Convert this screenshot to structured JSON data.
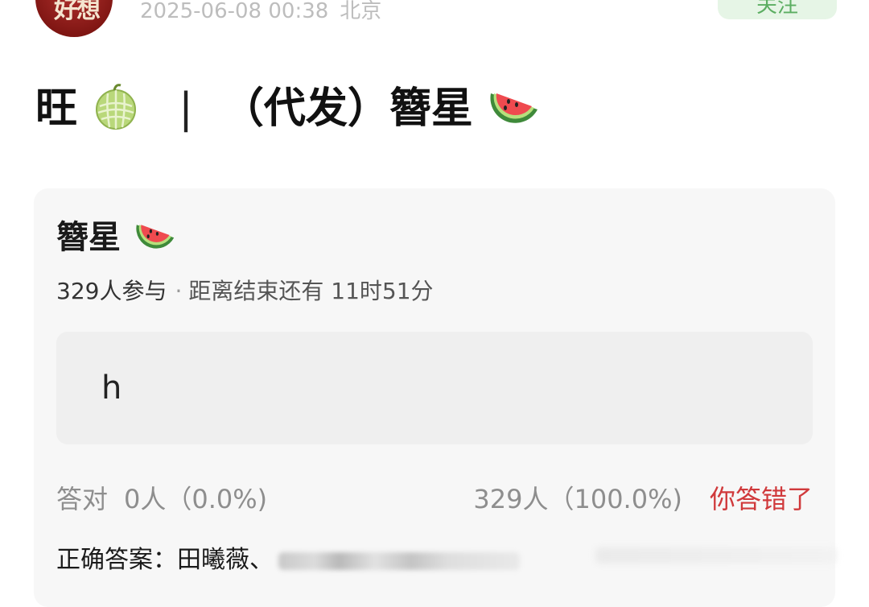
{
  "header": {
    "avatar_text": "好想",
    "timestamp": "2025-06-08 00:38",
    "location": "北京",
    "follow_label": "关注"
  },
  "post": {
    "title_prefix": "旺",
    "separator": "|",
    "title_main": "（代发）簪星",
    "title_icon_1": "melon-emoji-icon",
    "title_icon_2": "watermelon-emoji-icon"
  },
  "quiz": {
    "title": "簪星",
    "participants": "329人参与",
    "dot": "·",
    "countdown": "距离结束还有 11时51分",
    "answer": "h",
    "correct_label": "答对",
    "correct_stat": "0人（0.0%)",
    "answer_stat": "329人（100.0%)",
    "result_text": "你答错了",
    "correct_answer_label": "正确答案：田曦薇、"
  },
  "colors": {
    "accent_red": "#d0393b",
    "follow_green": "#5cae62",
    "card_bg": "#f7f7f7"
  }
}
